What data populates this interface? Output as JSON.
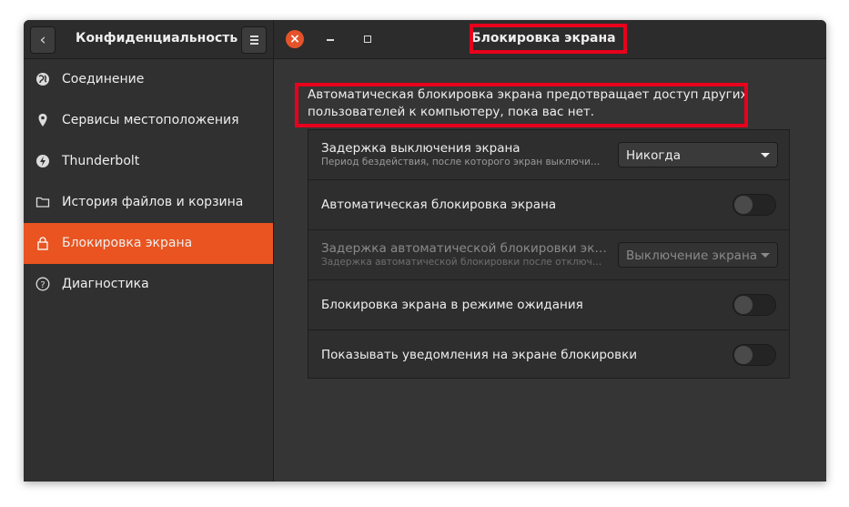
{
  "sidebar_header": {
    "back_icon": "chevron-left-icon",
    "title": "Конфиденциальность",
    "menu_icon": "hamburger-icon"
  },
  "main_header": {
    "close_icon": "close-icon",
    "minimize_icon": "minimize-icon",
    "maximize_icon": "maximize-icon",
    "title": "Блокировка экрана"
  },
  "sidebar": {
    "items": [
      {
        "label": "Соединение",
        "icon": "globe-icon"
      },
      {
        "label": "Сервисы местоположения",
        "icon": "location-pin-icon"
      },
      {
        "label": "Thunderbolt",
        "icon": "thunderbolt-icon"
      },
      {
        "label": "История файлов и корзина",
        "icon": "folder-icon"
      },
      {
        "label": "Блокировка экрана",
        "icon": "lock-icon",
        "active": true
      },
      {
        "label": "Диагностика",
        "icon": "help-icon"
      }
    ]
  },
  "main": {
    "description": "Автоматическая блокировка экрана предотвращает доступ других пользователей к компьютеру, пока вас нет.",
    "settings": [
      {
        "title": "Задержка выключения экрана",
        "subtitle": "Период бездействия, после которого экран выключи…",
        "control": "dropdown",
        "value": "Никогда"
      },
      {
        "title": "Автоматическая блокировка экрана",
        "control": "toggle",
        "state": "off"
      },
      {
        "title": "Задержка автоматической блокировки эк…",
        "subtitle": "Задержка автоматической блокировки после отключ…",
        "control": "dropdown",
        "value": "Выключение экрана",
        "disabled": true
      },
      {
        "title": "Блокировка экрана в режиме ожидания",
        "control": "toggle",
        "state": "off"
      },
      {
        "title": "Показывать уведомления на экране блокировки",
        "control": "toggle",
        "state": "off"
      }
    ]
  },
  "colors": {
    "accent": "#e95420",
    "highlight_box": "#e8001c",
    "close_button": "#e5532a"
  }
}
